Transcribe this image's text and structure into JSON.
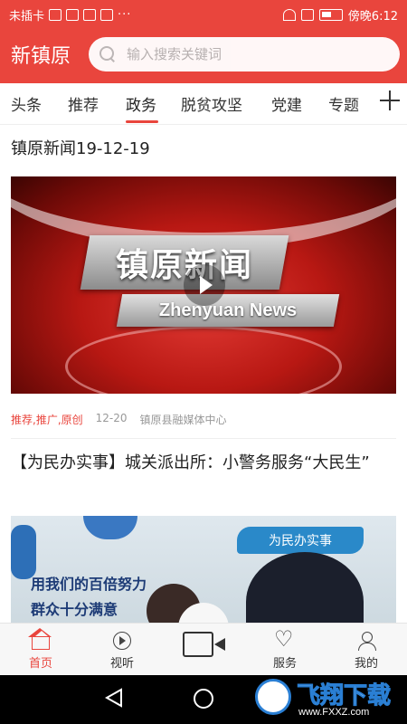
{
  "status_bar": {
    "carrier": "未插卡",
    "dots": "···",
    "time": "傍晚6:12"
  },
  "header": {
    "app_title": "新镇原",
    "search_placeholder": "输入搜索关键词"
  },
  "tabs": [
    {
      "label": "头条"
    },
    {
      "label": "推荐"
    },
    {
      "label": "政务",
      "active": true
    },
    {
      "label": "脱贫攻坚"
    },
    {
      "label": "党建"
    },
    {
      "label": "专题"
    }
  ],
  "articles": [
    {
      "title": "镇原新闻19-12-19",
      "thumb_title_cn": "镇原新闻",
      "thumb_title_en": "Zhenyuan News",
      "tags": "推荐,推广,原创",
      "date": "12-20",
      "source": "镇原县融媒体中心"
    },
    {
      "title": "【为民办实事】城关派出所：小警务服务“大民生”",
      "thumb_banner": "为民办实事",
      "thumb_slogan1": "用我们的百倍努力",
      "thumb_slogan2": "群众十分满意"
    }
  ],
  "bottom_nav": {
    "home": "首页",
    "listen": "视听",
    "service": "服务",
    "mine": "我的"
  },
  "watermark": {
    "text": "飞翔下载",
    "url": "www.FXXZ.com"
  },
  "colors": {
    "brand_red": "#e9453d",
    "tag_red": "#e9453d"
  }
}
